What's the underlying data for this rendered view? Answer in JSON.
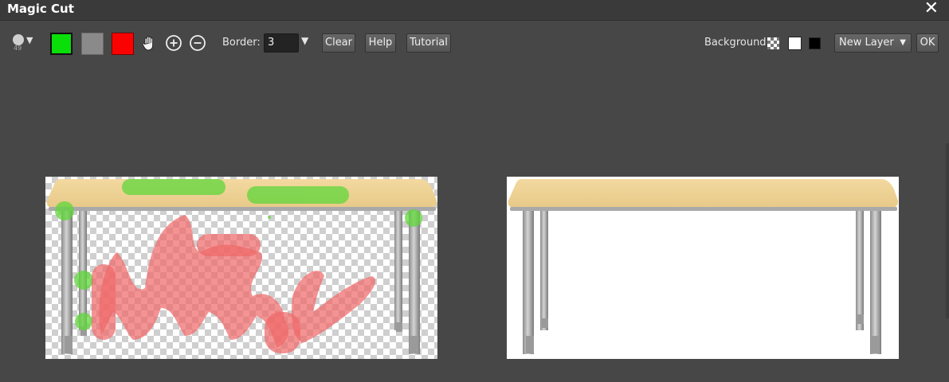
{
  "window": {
    "title": "Magic Cut",
    "close_glyph": "✕"
  },
  "toolbar": {
    "brush_size": "49",
    "brush_caret": "▼",
    "swatches": [
      {
        "name": "foreground-keep",
        "color": "#0adf0a"
      },
      {
        "name": "neutral",
        "color": "#8a8a8a"
      },
      {
        "name": "background-remove",
        "color": "#fb0202"
      }
    ],
    "tools": [
      "hand-icon",
      "zoom-in-icon",
      "zoom-out-icon"
    ],
    "border_label": "Border:",
    "border_value": "3",
    "border_caret": "▼",
    "buttons": {
      "clear": "Clear",
      "help": "Help",
      "tutorial": "Tutorial",
      "ok": "OK"
    },
    "background_label": "Background:",
    "background_options": [
      "transparent-checker",
      "white",
      "black"
    ],
    "layer_select_value": "New Layer",
    "layer_select_caret": "▼"
  },
  "panels": {
    "left": {
      "name": "mask-edit-canvas",
      "background": "transparent-checker"
    },
    "right": {
      "name": "result-preview-canvas",
      "background": "#ffffff"
    }
  },
  "colors": {
    "app_bg": "#474747",
    "titlebar_bg": "#3a3a3a",
    "keep_stroke": "#7ddc4f",
    "remove_stroke": "#f06a6a",
    "table_top": "#efd293"
  }
}
